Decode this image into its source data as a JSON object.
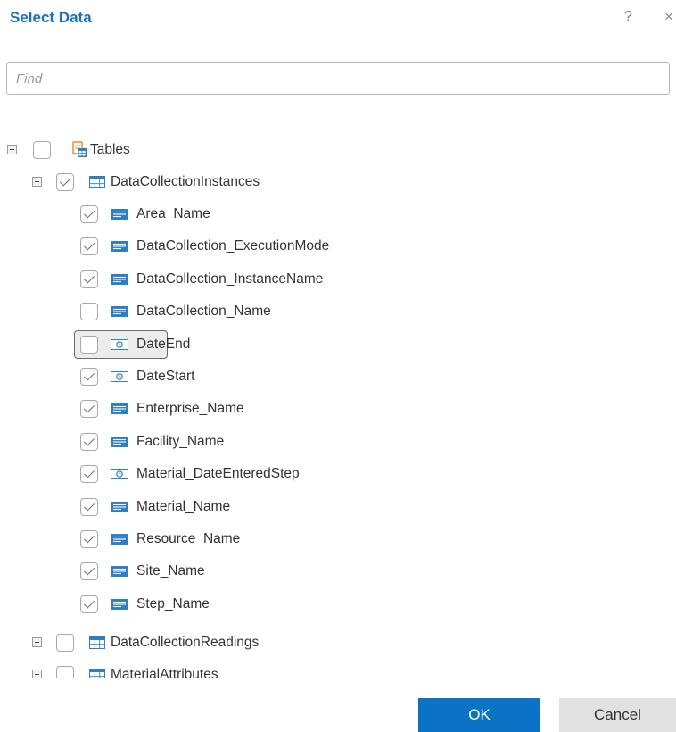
{
  "dialog": {
    "title": "Select Data",
    "help_icon": "?",
    "close_icon": "×"
  },
  "search": {
    "placeholder": "Find",
    "value": ""
  },
  "tree": {
    "root": {
      "label": "Tables",
      "checked": false,
      "expanded": true,
      "icon": "tables-icon"
    },
    "tables": [
      {
        "label": "DataCollectionInstances",
        "checked": true,
        "expanded": true,
        "icon": "table-icon",
        "columns": [
          {
            "label": "Area_Name",
            "checked": true,
            "type": "text"
          },
          {
            "label": "DataCollection_ExecutionMode",
            "checked": true,
            "type": "text"
          },
          {
            "label": "DataCollection_InstanceName",
            "checked": true,
            "type": "text"
          },
          {
            "label": "DataCollection_Name",
            "checked": false,
            "type": "text"
          },
          {
            "label": "DateEnd",
            "checked": false,
            "type": "datetime",
            "focused": true
          },
          {
            "label": "DateStart",
            "checked": true,
            "type": "datetime"
          },
          {
            "label": "Enterprise_Name",
            "checked": true,
            "type": "text"
          },
          {
            "label": "Facility_Name",
            "checked": true,
            "type": "text"
          },
          {
            "label": "Material_DateEnteredStep",
            "checked": true,
            "type": "datetime"
          },
          {
            "label": "Material_Name",
            "checked": true,
            "type": "text"
          },
          {
            "label": "Resource_Name",
            "checked": true,
            "type": "text"
          },
          {
            "label": "Site_Name",
            "checked": true,
            "type": "text"
          },
          {
            "label": "Step_Name",
            "checked": true,
            "type": "text"
          }
        ]
      },
      {
        "label": "DataCollectionReadings",
        "checked": false,
        "expanded": false,
        "icon": "table-icon"
      },
      {
        "label": "MaterialAttributes",
        "checked": false,
        "expanded": false,
        "icon": "table-icon"
      }
    ]
  },
  "footer": {
    "ok_label": "OK",
    "cancel_label": "Cancel"
  },
  "colors": {
    "title": "#1a73b8",
    "primary_button": "#0a73c4",
    "secondary_button": "#e1e1e1",
    "table_icon": "#2f7fc1",
    "tables_icon": "#e8872a"
  }
}
